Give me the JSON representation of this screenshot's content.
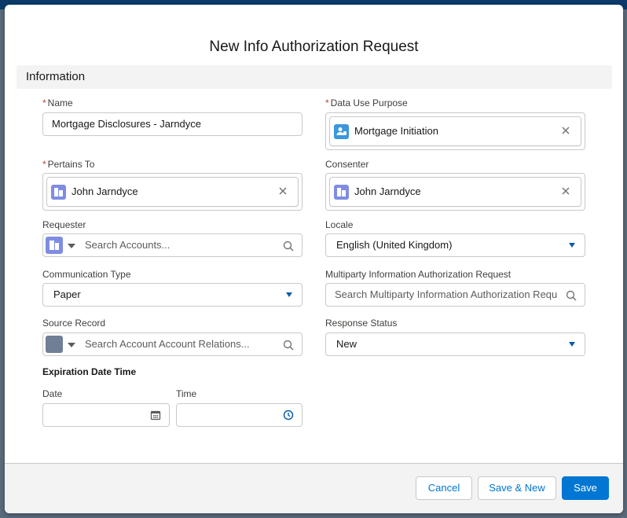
{
  "modal": {
    "title": "New Info Authorization Request",
    "section": "Information"
  },
  "fields": {
    "name": {
      "label": "Name",
      "value": "Mortgage Disclosures - Jarndyce",
      "required": true
    },
    "data_use_purpose": {
      "label": "Data Use Purpose",
      "value": "Mortgage Initiation",
      "required": true,
      "icon": "data-use-purpose-icon"
    },
    "pertains_to": {
      "label": "Pertains To",
      "value": "John Jarndyce",
      "required": true,
      "icon": "account-icon"
    },
    "consenter": {
      "label": "Consenter",
      "value": "John Jarndyce",
      "icon": "account-icon"
    },
    "requester": {
      "label": "Requester",
      "placeholder": "Search Accounts...",
      "icon": "account-icon"
    },
    "locale": {
      "label": "Locale",
      "value": "English (United Kingdom)"
    },
    "communication_type": {
      "label": "Communication Type",
      "value": "Paper"
    },
    "multiparty": {
      "label": "Multiparty Information Authorization Request",
      "placeholder": "Search Multiparty Information Authorization Requ"
    },
    "source_record": {
      "label": "Source Record",
      "placeholder": "Search Account Account Relations...",
      "icon": "account-relation-icon"
    },
    "response_status": {
      "label": "Response Status",
      "value": "New"
    },
    "expiration": {
      "heading": "Expiration Date Time",
      "date_label": "Date",
      "time_label": "Time"
    }
  },
  "footer": {
    "cancel": "Cancel",
    "save_new": "Save & New",
    "save": "Save"
  },
  "colors": {
    "brand": "#0176d3",
    "required": "#c23934",
    "account_icon": "#7f8de1",
    "purpose_icon": "#3c97dd",
    "relation_icon": "#707e96"
  }
}
